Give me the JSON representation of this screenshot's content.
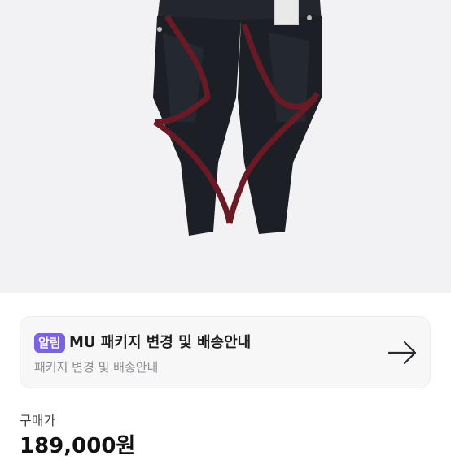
{
  "product": {
    "image_alt": "pants-product-photo"
  },
  "notice": {
    "badge": "알림",
    "title": "MU 패키지 변경 및 배송안내",
    "subtitle": "패키지 변경 및 배송안내",
    "icon": "arrow-right-icon"
  },
  "price": {
    "label": "구매가",
    "value": "189,000원"
  },
  "colors": {
    "badge_bg": "#7b61e6",
    "card_bg": "#f7f7f8",
    "hero_bg": "#f2f2f4",
    "pants": "#1c1f26",
    "accent_stripe": "#6a1a24"
  }
}
